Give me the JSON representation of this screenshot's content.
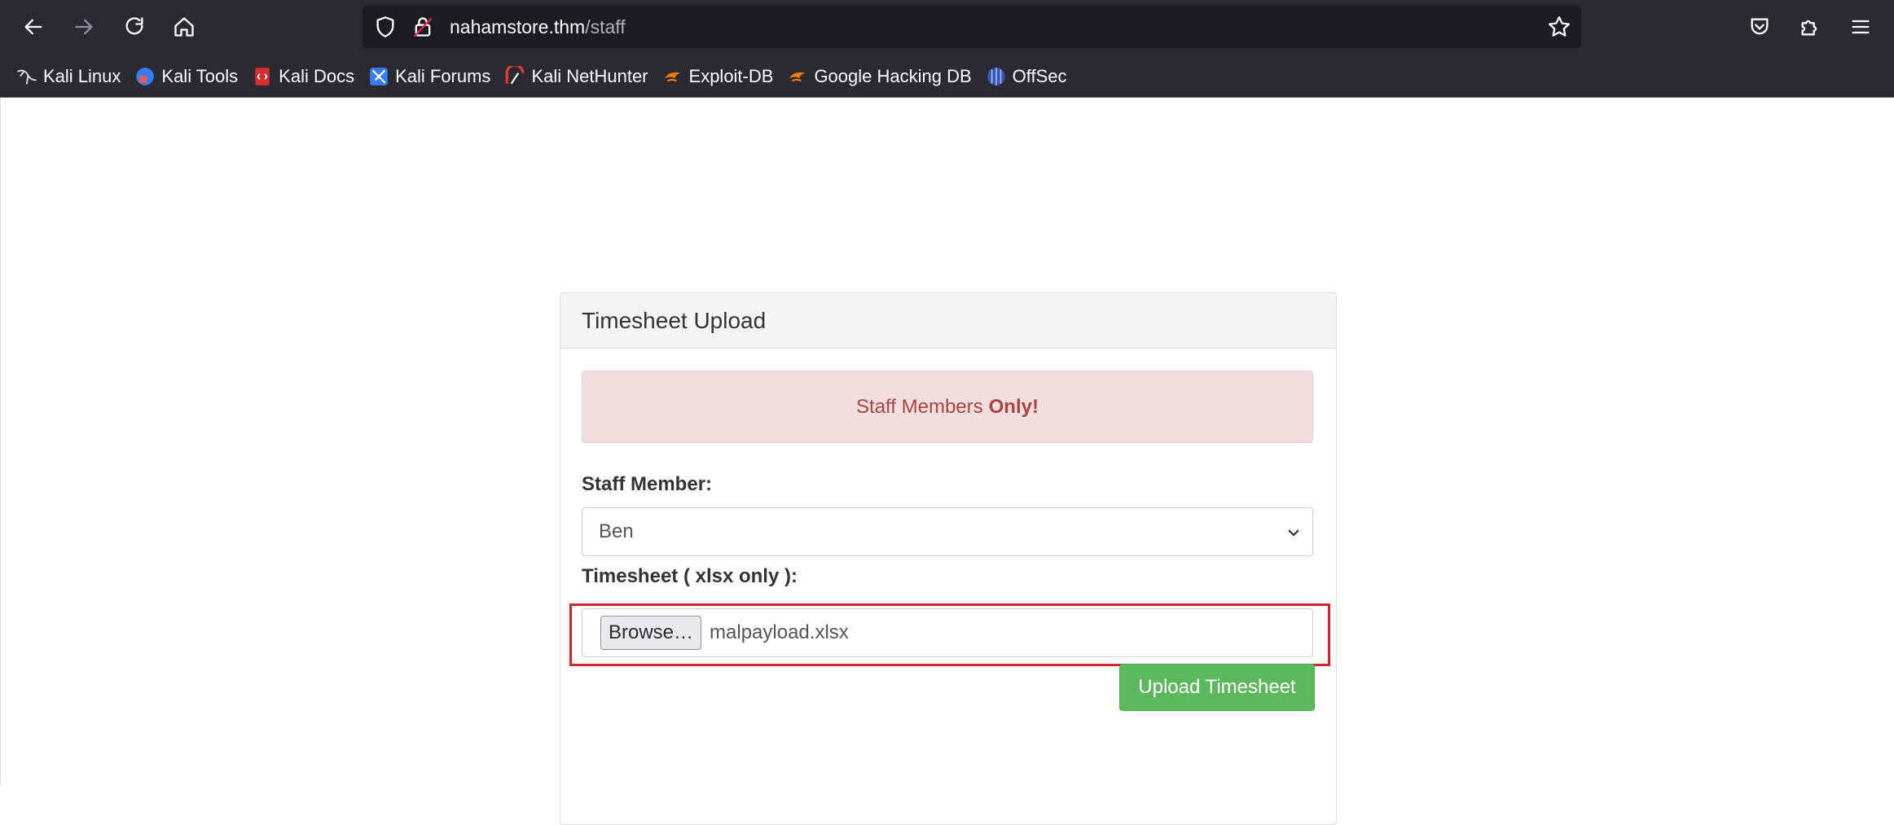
{
  "browser": {
    "url_host": "nahamstore.thm",
    "url_path": "/staff",
    "bookmarks": [
      {
        "label": "Kali Linux",
        "icon": "kali-dragon-icon"
      },
      {
        "label": "Kali Tools",
        "icon": "kali-tools-icon"
      },
      {
        "label": "Kali Docs",
        "icon": "kali-docs-icon"
      },
      {
        "label": "Kali Forums",
        "icon": "kali-forums-icon"
      },
      {
        "label": "Kali NetHunter",
        "icon": "kali-nethunter-icon"
      },
      {
        "label": "Exploit-DB",
        "icon": "exploit-db-icon"
      },
      {
        "label": "Google Hacking DB",
        "icon": "ghdb-icon"
      },
      {
        "label": "OffSec",
        "icon": "offsec-icon"
      }
    ]
  },
  "panel": {
    "title": "Timesheet Upload",
    "alert_text": "Staff Members",
    "alert_bold": "Only!",
    "staff_label": "Staff Member:",
    "staff_selected": "Ben",
    "timesheet_label": "Timesheet ( xlsx only ):",
    "browse_label": "Browse…",
    "file_name": "malpayload.xlsx",
    "submit_label": "Upload Timesheet"
  },
  "colors": {
    "chrome_bg": "#2b2a33",
    "alert_bg": "#f2dede",
    "alert_text": "#a94442",
    "submit_bg": "#5cb85c",
    "highlight_border": "#d9232a"
  }
}
